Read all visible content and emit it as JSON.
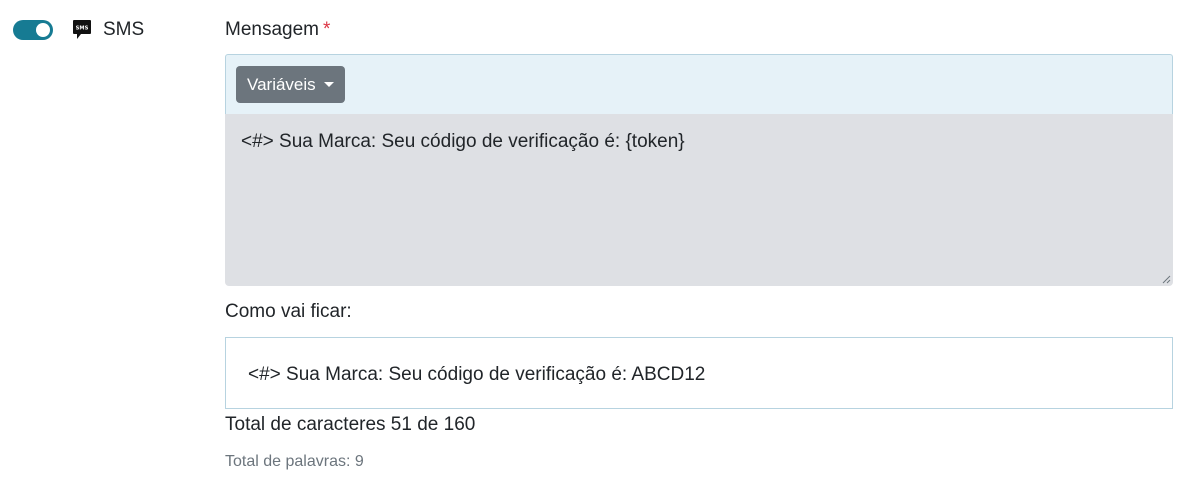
{
  "channel": {
    "toggle_on": true,
    "icon": "sms-icon",
    "label": "SMS",
    "accent_color": "#167b93"
  },
  "message": {
    "label": "Mensagem",
    "required_mark": "*",
    "variables_button": "Variáveis",
    "value": "<#> Sua Marca: Seu código de verificação é:  {token}"
  },
  "preview": {
    "label": "Como vai ficar:",
    "text": "<#> Sua Marca: Seu código de verificação é: ABCD12"
  },
  "stats": {
    "characters": "Total de caracteres 51 de 160",
    "words": "Total de palavras: 9"
  }
}
